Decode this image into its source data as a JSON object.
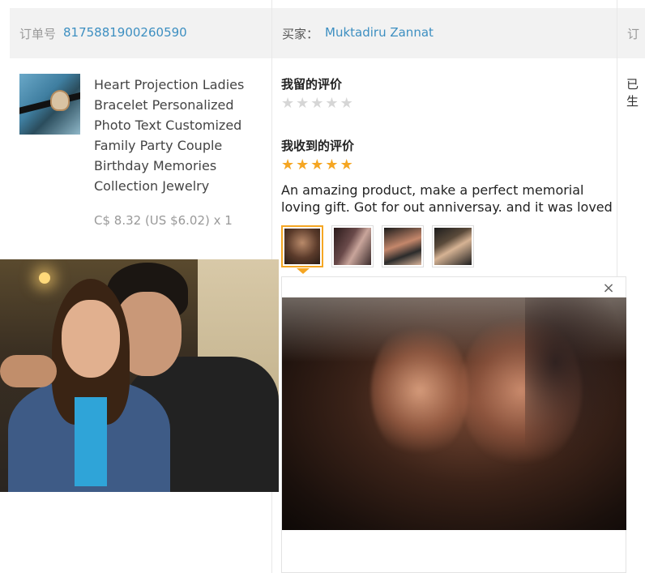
{
  "header": {
    "order_label": "订单号",
    "order_number": "8175881900260590",
    "buyer_label": "买家：",
    "buyer_name": "Muktadiru Zannat",
    "order_clipped": "订"
  },
  "product": {
    "title": "Heart Projection Ladies Bracelet Personalized Photo Text Customized Family Party Couple Birthday Memories Collection Jewelry",
    "price": "C$ 8.32 (US $6.02) x 1"
  },
  "review": {
    "my_review_heading": "我留的评价",
    "my_review_stars": 0,
    "received_review_heading": "我收到的评价",
    "received_review_stars": 5,
    "text": "An amazing product, make a perfect memorial loving gift. Got for out anniversay. and it was loved",
    "thumbnails": [
      "photo-1",
      "photo-2",
      "photo-3",
      "photo-4"
    ],
    "selected_thumbnail": 0,
    "close_icon": "×"
  },
  "status": {
    "clipped": "已生"
  },
  "colors": {
    "link": "#3d8fc1",
    "star": "#f5a623",
    "header_bg": "#f2f2f2"
  }
}
